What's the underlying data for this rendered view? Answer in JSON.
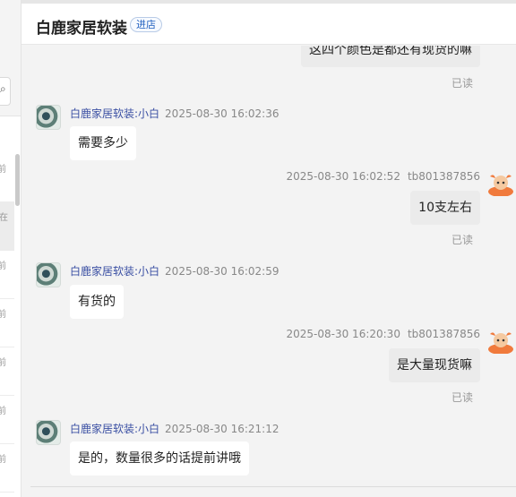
{
  "left_panel": {
    "search_icon": "search-icon",
    "conversations": [
      {
        "time": "前"
      },
      {
        "time": "在"
      },
      {
        "time": "前"
      },
      {
        "time": "前"
      },
      {
        "time": "前"
      },
      {
        "time": "前"
      },
      {
        "time": "前"
      }
    ]
  },
  "header": {
    "shop_name": "白鹿家居软装",
    "enter_label": "进店"
  },
  "messages": {
    "m0": {
      "text": "这四个颜色是都还有现货的嘛",
      "read": "已读"
    },
    "m1": {
      "sender": "白鹿家居软装:小白",
      "time": "2025-08-30 16:02:36",
      "text": "需要多少"
    },
    "m2": {
      "sender": "tb801387856",
      "time": "2025-08-30 16:02:52",
      "text": "10支左右",
      "read": "已读"
    },
    "m3": {
      "sender": "白鹿家居软装:小白",
      "time": "2025-08-30 16:02:59",
      "text": "有货的"
    },
    "m4": {
      "sender": "tb801387856",
      "time": "2025-08-30 16:20:30",
      "text": "是大量现货嘛",
      "read": "已读"
    },
    "m5": {
      "sender": "白鹿家居软装:小白",
      "time": "2025-08-30 16:21:12",
      "text": "是的，数量很多的话提前讲哦"
    }
  },
  "colors": {
    "accent_blue": "#3a4fa3",
    "user_avatar": "#f07a3c"
  }
}
